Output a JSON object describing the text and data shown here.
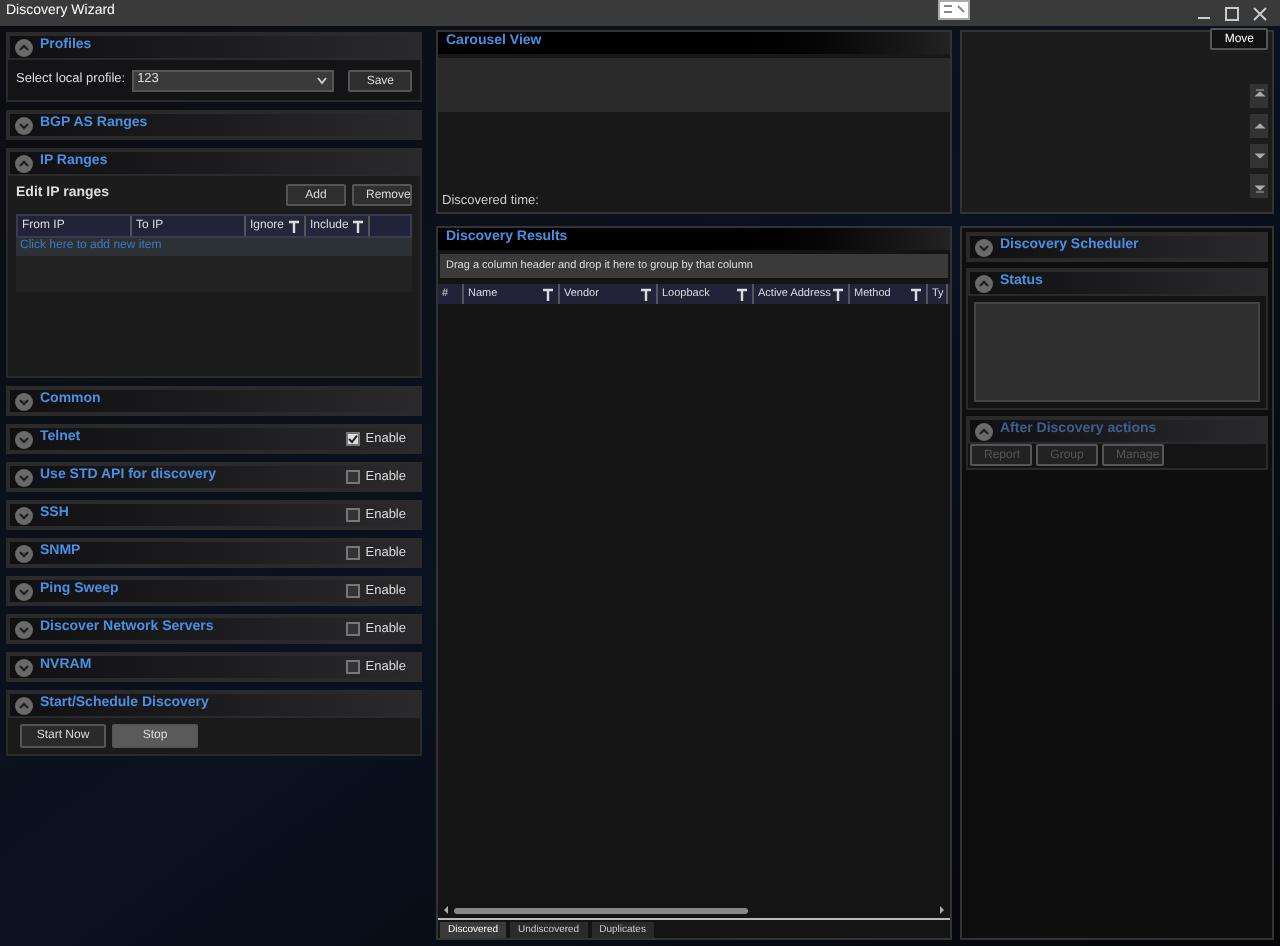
{
  "window": {
    "title": "Discovery Wizard",
    "move_button": "Move"
  },
  "left_panel": {
    "sections": [
      {
        "kind": "profiles",
        "title": "Profiles",
        "expanded": true,
        "label": "Select local profile:",
        "value": "123",
        "button": "Save"
      },
      {
        "kind": "plain",
        "title": "BGP AS Ranges",
        "expanded": false
      },
      {
        "kind": "ip_ranges",
        "title": "IP Ranges",
        "expanded": true,
        "heading": "Edit IP ranges",
        "buttons": [
          "Add",
          "Remove"
        ],
        "columns": [
          {
            "label": "From IP",
            "filter": false
          },
          {
            "label": "To IP",
            "filter": false
          },
          {
            "label": "Ignore",
            "filter": true
          },
          {
            "label": "Include",
            "filter": true
          }
        ],
        "new_row": "Click here to add new item"
      },
      {
        "kind": "plain",
        "title": "Common",
        "expanded": false
      },
      {
        "kind": "toggle",
        "title": "Telnet",
        "expanded": false,
        "label": "Enable",
        "checked": true
      },
      {
        "kind": "toggle",
        "title": "Use STD API for discovery",
        "expanded": false,
        "label": "Enable",
        "checked": false
      },
      {
        "kind": "toggle",
        "title": "SSH",
        "expanded": false,
        "label": "Enable",
        "checked": false
      },
      {
        "kind": "toggle",
        "title": "SNMP",
        "expanded": false,
        "label": "Enable",
        "checked": false
      },
      {
        "kind": "toggle",
        "title": "Ping Sweep",
        "expanded": false,
        "label": "Enable",
        "checked": false
      },
      {
        "kind": "toggle",
        "title": "Discover Network Servers",
        "expanded": false,
        "label": "Enable",
        "checked": false
      },
      {
        "kind": "toggle",
        "title": "NVRAM",
        "expanded": false,
        "label": "Enable",
        "checked": false
      },
      {
        "kind": "actions",
        "title": "Start/Schedule Discovery",
        "expanded": true,
        "buttons": [
          {
            "label": "Start Now",
            "selected": false
          },
          {
            "label": "Stop",
            "selected": true
          }
        ]
      }
    ]
  },
  "carousel": {
    "title": "Carousel View",
    "discovered_time": "Discovered time:"
  },
  "results": {
    "title": "Discovery Results",
    "group_hint": "Drag a column header and drop it here to group by that column",
    "columns": [
      {
        "label": "#",
        "filter": false
      },
      {
        "label": "Name",
        "filter": true
      },
      {
        "label": "Vendor",
        "filter": true
      },
      {
        "label": "Loopback",
        "filter": true
      },
      {
        "label": "Active Address",
        "filter": true
      },
      {
        "label": "Method",
        "filter": true
      },
      {
        "label": "Ty",
        "filter": false
      }
    ],
    "tabs": [
      {
        "label": "Discovered",
        "selected": true
      },
      {
        "label": "Undiscovered",
        "selected": false
      },
      {
        "label": "Duplicates",
        "selected": false
      }
    ]
  },
  "right_panel": {
    "sections": [
      {
        "kind": "plain",
        "title": "Discovery Scheduler",
        "expanded": false,
        "disabled": false
      },
      {
        "kind": "status",
        "title": "Status",
        "expanded": true,
        "disabled": false
      },
      {
        "kind": "buttons",
        "title": "After Discovery actions",
        "expanded": true,
        "disabled": true,
        "buttons": [
          "Report",
          "Group",
          "Manage"
        ]
      }
    ]
  }
}
